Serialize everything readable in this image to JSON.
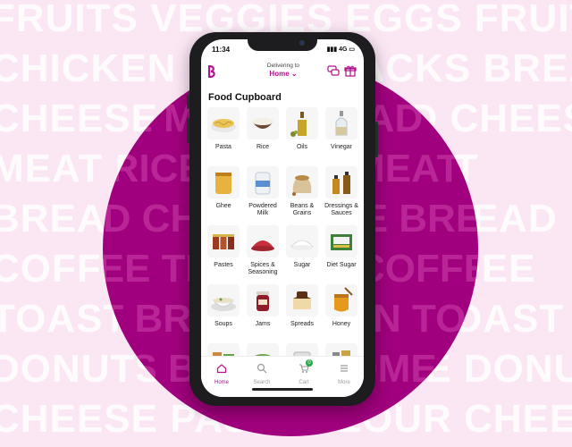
{
  "background_words": [
    "FRUITS VEGGIES EGGS FRUITS",
    "CHICKEN MILK SNACKS BREAD",
    "CHEESE MEAT BREAD CHEESE",
    "MEAT RICE PASTA MEAT",
    "BREAD CHOCOLATE BREAD",
    "COFFEE TEA MILK COFFEE",
    "TOAST BREAD CORN TOAST",
    "DONUTS BREAD HOME DONUTS",
    "CHEESE PASTA FLOUR CHEESE"
  ],
  "colors": {
    "page_bg": "#fbe6f4",
    "circle": "#a0007d",
    "brand": "#b0138b"
  },
  "status_bar": {
    "time": "11:34",
    "network": "4G"
  },
  "header": {
    "delivering_label": "Delivering to",
    "location": "Home ⌄",
    "icons": [
      "logo-icon",
      "chat-icon",
      "gift-icon"
    ]
  },
  "page_title": "Food Cupboard",
  "categories": [
    {
      "label": "Pasta",
      "icon": "pasta-bowl"
    },
    {
      "label": "Rice",
      "icon": "rice-bowl"
    },
    {
      "label": "Oils",
      "icon": "oil-bottle"
    },
    {
      "label": "Vinegar",
      "icon": "vinegar-bottle"
    },
    {
      "label": "Ghee",
      "icon": "ghee-jar"
    },
    {
      "label": "Powdered Milk",
      "icon": "milk-tin"
    },
    {
      "label": "Beans & Grains",
      "icon": "beans-sack"
    },
    {
      "label": "Dressings & Sauces",
      "icon": "sauce-bottles"
    },
    {
      "label": "Pastes",
      "icon": "paste-jars"
    },
    {
      "label": "Spices & Seasoning",
      "icon": "spice-pile"
    },
    {
      "label": "Sugar",
      "icon": "sugar-bowl"
    },
    {
      "label": "Diet Sugar",
      "icon": "diet-sugar-box"
    },
    {
      "label": "Soups",
      "icon": "soup-bowl"
    },
    {
      "label": "Jams",
      "icon": "jam-jar"
    },
    {
      "label": "Spreads",
      "icon": "spread-jar"
    },
    {
      "label": "Honey",
      "icon": "honey-jar"
    },
    {
      "label": "",
      "icon": "mixed-items"
    },
    {
      "label": "",
      "icon": "salad-bowl"
    },
    {
      "label": "",
      "icon": "canned-food"
    },
    {
      "label": "",
      "icon": "kitchen-tools"
    }
  ],
  "nav": {
    "home": "Home",
    "search": "Search",
    "cart": "Cart",
    "cart_count": "0",
    "more": "More"
  }
}
